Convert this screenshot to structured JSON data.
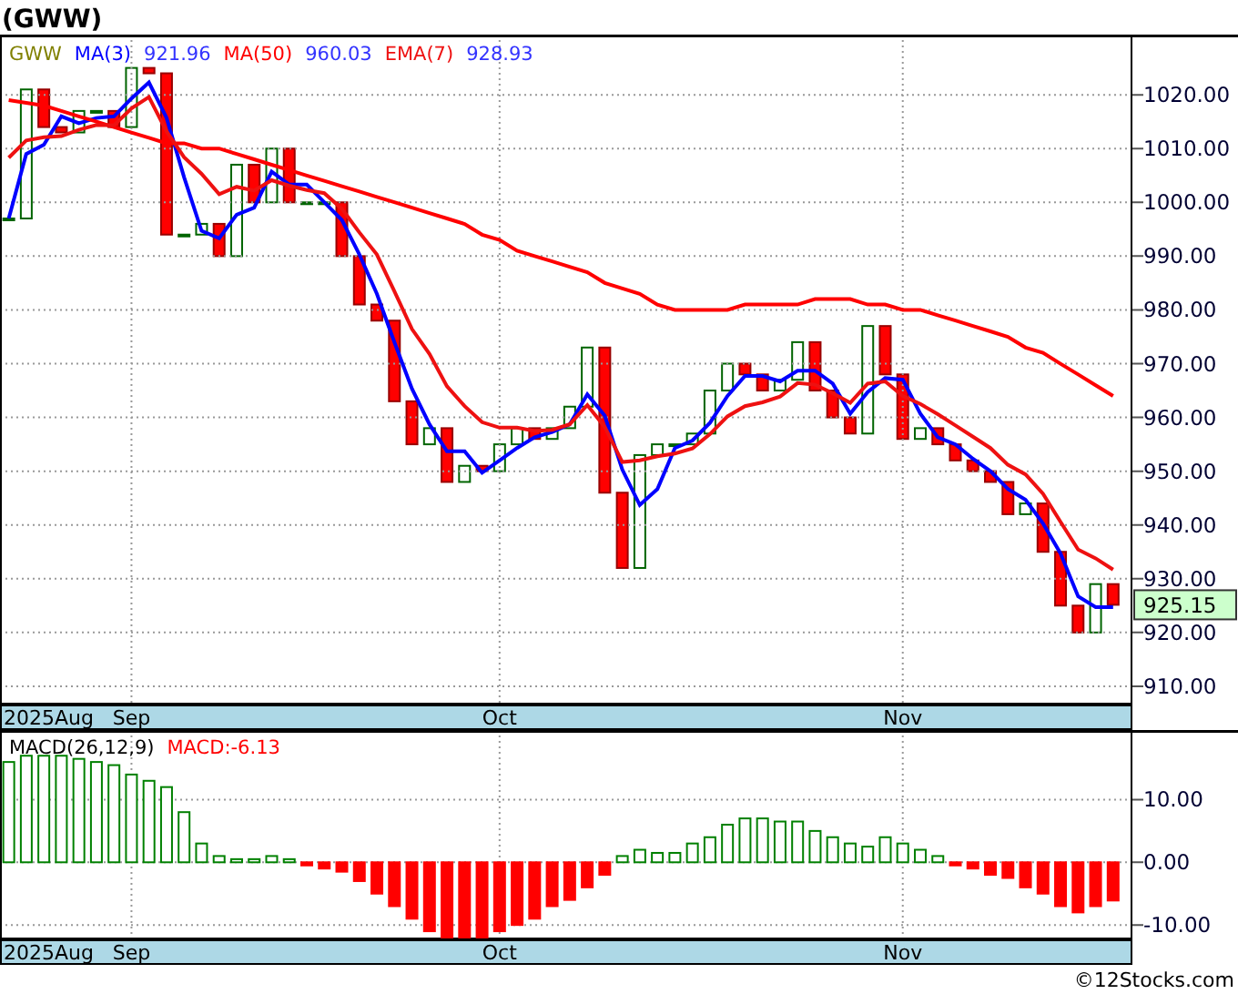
{
  "title": "(GWW)",
  "price_chart": {
    "symbol": "GWW",
    "legend_values": [
      "921.96",
      "960.03",
      "928.93"
    ],
    "last_price": "925.15",
    "date_labels": [
      "2025Aug",
      "Sep",
      "Oct",
      "Nov"
    ],
    "chart_data": {
      "type": "line",
      "grid": true,
      "ylim": [
        906.6,
        1031.2
      ],
      "yticks": [
        {
          "value": 910,
          "label": "910.00"
        },
        {
          "value": 920,
          "label": "920.00"
        },
        {
          "value": 930,
          "label": "930.00"
        },
        {
          "value": 940,
          "label": "940.00"
        },
        {
          "value": 950,
          "label": "950.00"
        },
        {
          "value": 960,
          "label": "960.00"
        },
        {
          "value": 970,
          "label": "970.00"
        },
        {
          "value": 980,
          "label": "980.00"
        },
        {
          "value": 990,
          "label": "990.00"
        },
        {
          "value": 1000,
          "label": "1000.00"
        },
        {
          "value": 1010,
          "label": "1010.00"
        },
        {
          "value": 1020,
          "label": "1020.00"
        }
      ],
      "series": [
        {
          "name": "MA(3)",
          "color": "#0000ff",
          "values": [
            997,
            1009,
            1010.7,
            1016,
            1014.7,
            1015.7,
            1016,
            1019.3,
            1022.3,
            1015.7,
            1004.7,
            994.7,
            993.3,
            997.7,
            999,
            1005.7,
            1003.3,
            1003.3,
            1000,
            996.7,
            990.3,
            983,
            974,
            965.3,
            958.7,
            953.7,
            953.7,
            949.7,
            952,
            954.3,
            956.3,
            957.3,
            958.7,
            964.3,
            960.3,
            950.3,
            943.7,
            946.7,
            954.3,
            955.7,
            959,
            964,
            967.7,
            967.7,
            966.7,
            968.7,
            968.7,
            966.3,
            960.7,
            964.7,
            967.3,
            967,
            960.7,
            956.3,
            955,
            952.3,
            950,
            946.7,
            944.7,
            940.3,
            934.7,
            926.7,
            924.7,
            924.7
          ]
        },
        {
          "name": "MA(50)",
          "color": "#ff0000",
          "values": [
            1019,
            1018.5,
            1018,
            1017,
            1016,
            1015,
            1014,
            1013,
            1012,
            1011,
            1011,
            1010,
            1010,
            1009,
            1008,
            1007,
            1006,
            1005,
            1004,
            1003,
            1002,
            1001,
            1000,
            999,
            998,
            997,
            996,
            994,
            993,
            991,
            990,
            989,
            988,
            987,
            985,
            984,
            983,
            981,
            980,
            980,
            980,
            980,
            981,
            981,
            981,
            981,
            982,
            982,
            982,
            981,
            981,
            980,
            980,
            979,
            978,
            977,
            976,
            975,
            973,
            972,
            970,
            968,
            966,
            964
          ]
        },
        {
          "name": "EMA(7)",
          "color": "#ee1111",
          "values": [
            1008.3,
            1011.5,
            1012.1,
            1012.3,
            1013.5,
            1014.4,
            1014.3,
            1017.5,
            1019.6,
            1013.2,
            1008.4,
            1005.3,
            1001.5,
            1002.9,
            1002.2,
            1004.1,
            1003.1,
            1002.3,
            1001.7,
            998.8,
            994.4,
            990.3,
            983.5,
            976.4,
            971.8,
            965.8,
            962.1,
            959.1,
            958.1,
            958.1,
            957.5,
            957.7,
            958.7,
            962.3,
            958.2,
            951.7,
            952,
            952.8,
            953.3,
            954.2,
            956.9,
            960.2,
            962.1,
            962.8,
            963.9,
            966.4,
            966.1,
            964.5,
            962.7,
            966.3,
            966.7,
            964,
            962.5,
            960.6,
            958.5,
            956.4,
            954.3,
            951.2,
            949.4,
            945.8,
            940.6,
            935.4,
            933.8,
            931.7
          ]
        }
      ]
    }
  },
  "macd_chart": {
    "date_labels": [
      "2025Aug",
      "Sep",
      "Oct",
      "Nov"
    ],
    "chart_data": {
      "type": "bar",
      "grid": true,
      "ylim": [
        -12.3,
        21.1
      ],
      "yticks": [
        {
          "value": -10,
          "label": "-10.00"
        },
        {
          "value": 0,
          "label": "0.00"
        },
        {
          "value": 10,
          "label": "10.00"
        }
      ],
      "series": [
        {
          "name": "MACD(26,12,9)",
          "color": "#008000",
          "values": [
            16,
            17,
            17,
            17,
            16.5,
            16,
            15.5,
            14,
            13,
            12,
            8,
            3,
            1,
            0.5,
            0.5,
            1,
            0.5,
            null,
            null,
            null,
            null,
            null,
            null,
            null,
            null,
            null,
            null,
            null,
            null,
            null,
            null,
            null,
            null,
            null,
            null,
            1,
            2,
            1.5,
            1.5,
            3,
            4,
            6,
            7,
            7,
            6.5,
            6.5,
            5,
            4,
            3,
            2.5,
            4,
            3,
            2,
            1,
            null,
            null,
            null,
            null,
            null,
            null,
            null,
            null,
            null,
            null
          ]
        },
        {
          "name": "MACD:-6.13",
          "color": "#ff0000",
          "values": [
            null,
            null,
            null,
            null,
            null,
            null,
            null,
            null,
            null,
            null,
            null,
            null,
            null,
            null,
            null,
            null,
            null,
            -0.5,
            -1,
            -1.5,
            -3,
            -5,
            -7,
            -9,
            -11,
            -12,
            -12,
            -12,
            -11,
            -10,
            -9,
            -7,
            -6,
            -4,
            -2,
            null,
            null,
            null,
            null,
            null,
            null,
            null,
            null,
            null,
            null,
            null,
            null,
            null,
            null,
            null,
            null,
            null,
            null,
            null,
            -0.5,
            -1,
            -2,
            -2.5,
            -4,
            -5,
            -7,
            -8,
            -7,
            -6.1
          ]
        }
      ]
    }
  },
  "credit": "©12Stocks.com"
}
